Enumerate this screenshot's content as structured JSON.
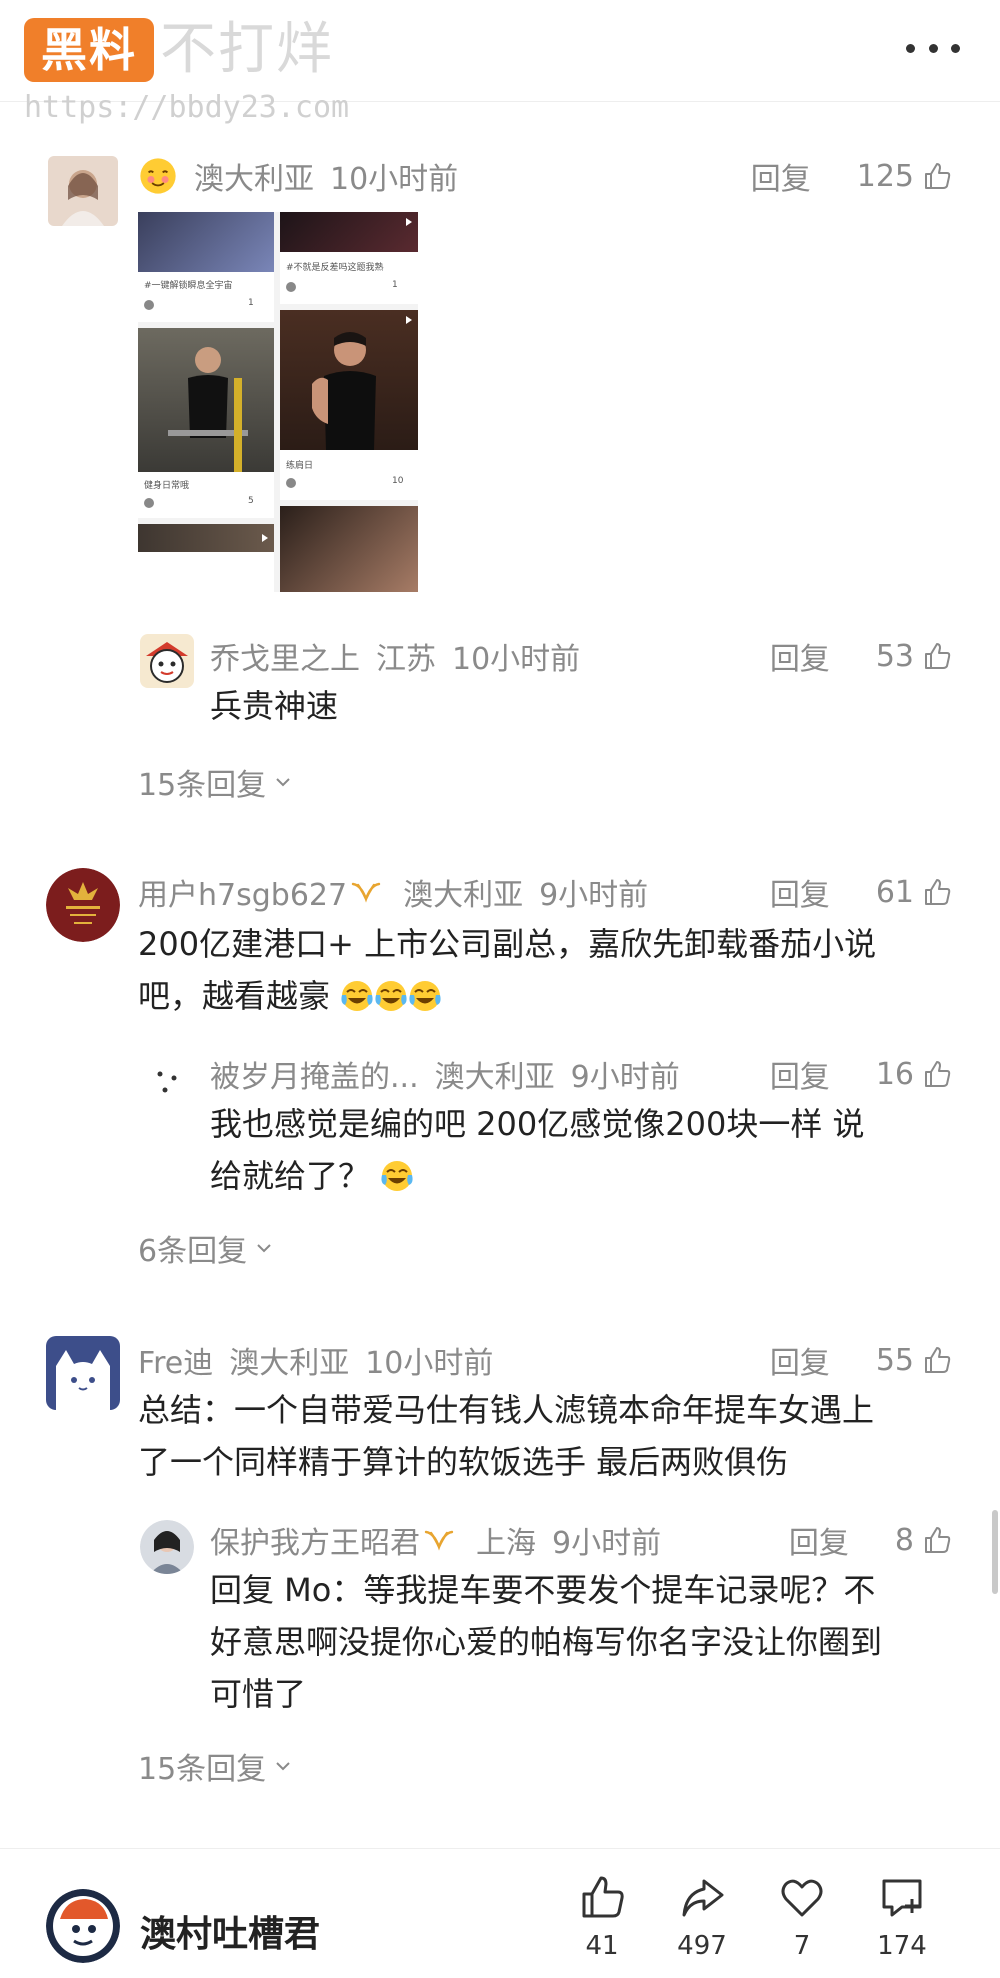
{
  "header": {
    "logo_text": "黑料",
    "slogan": "不打烊",
    "url": "https://bbdy23.com",
    "more_icon": "more-dots-icon"
  },
  "icons": {
    "like": "thumb-up-icon",
    "share": "share-icon",
    "favorite": "heart-icon",
    "comment": "comment-icon",
    "chevron": "chevron-down-icon",
    "vip": "vip-badge-icon"
  },
  "colors": {
    "brand": "#f07f2a",
    "meta_gray": "#8a8a8a",
    "text": "#222222"
  },
  "comments": [
    {
      "user": "",
      "location": "澳大利亚",
      "time": "10小时前",
      "reply_label": "回复",
      "likes": "125",
      "images": {
        "captions": [
          "#一键解锁瞬息全宇宙",
          "#不就是反差吗这题我熟",
          "健身日常哦",
          "练肩日"
        ],
        "like_counts": [
          "1",
          "1",
          "5",
          "10"
        ]
      },
      "replies": [
        {
          "user": "乔戈里之上",
          "location": "江苏",
          "time": "10小时前",
          "reply_label": "回复",
          "likes": "53",
          "text": "兵贵神速"
        }
      ],
      "more_replies": "15条回复"
    },
    {
      "user": "用户h7sgb627",
      "location": "澳大利亚",
      "time": "9小时前",
      "reply_label": "回复",
      "likes": "61",
      "text_line1": "200亿建港口+ 上市公司副总，嘉欣先卸载番茄小说",
      "text_line2": "吧，越看越豪",
      "replies": [
        {
          "user": "被岁月掩盖的...",
          "location": "澳大利亚",
          "time": "9小时前",
          "reply_label": "回复",
          "likes": "16",
          "text_line1": "我也感觉是编的吧 200亿感觉像200块一样 说",
          "text_line2": "给就给了？"
        }
      ],
      "more_replies": "6条回复"
    },
    {
      "user": "Fre迪",
      "location": "澳大利亚",
      "time": "10小时前",
      "reply_label": "回复",
      "likes": "55",
      "text_line1": "总结：一个自带爱马仕有钱人滤镜本命年提车女遇上",
      "text_line2": "了一个同样精于算计的软饭选手 最后两败俱伤",
      "replies": [
        {
          "user": "保护我方王昭君",
          "location": "上海",
          "time": "9小时前",
          "reply_label": "回复",
          "likes": "8",
          "text_line1": "回复 Mo：等我提车要不要发个提车记录呢？不",
          "text_line2": "好意思啊没提你心爱的帕梅写你名字没让你圈到",
          "text_line3": "可惜了"
        }
      ],
      "more_replies": "15条回复"
    }
  ],
  "bottom_bar": {
    "account_name": "澳村吐槽君",
    "likes": "41",
    "shares": "497",
    "favorites": "7",
    "comments": "174"
  }
}
